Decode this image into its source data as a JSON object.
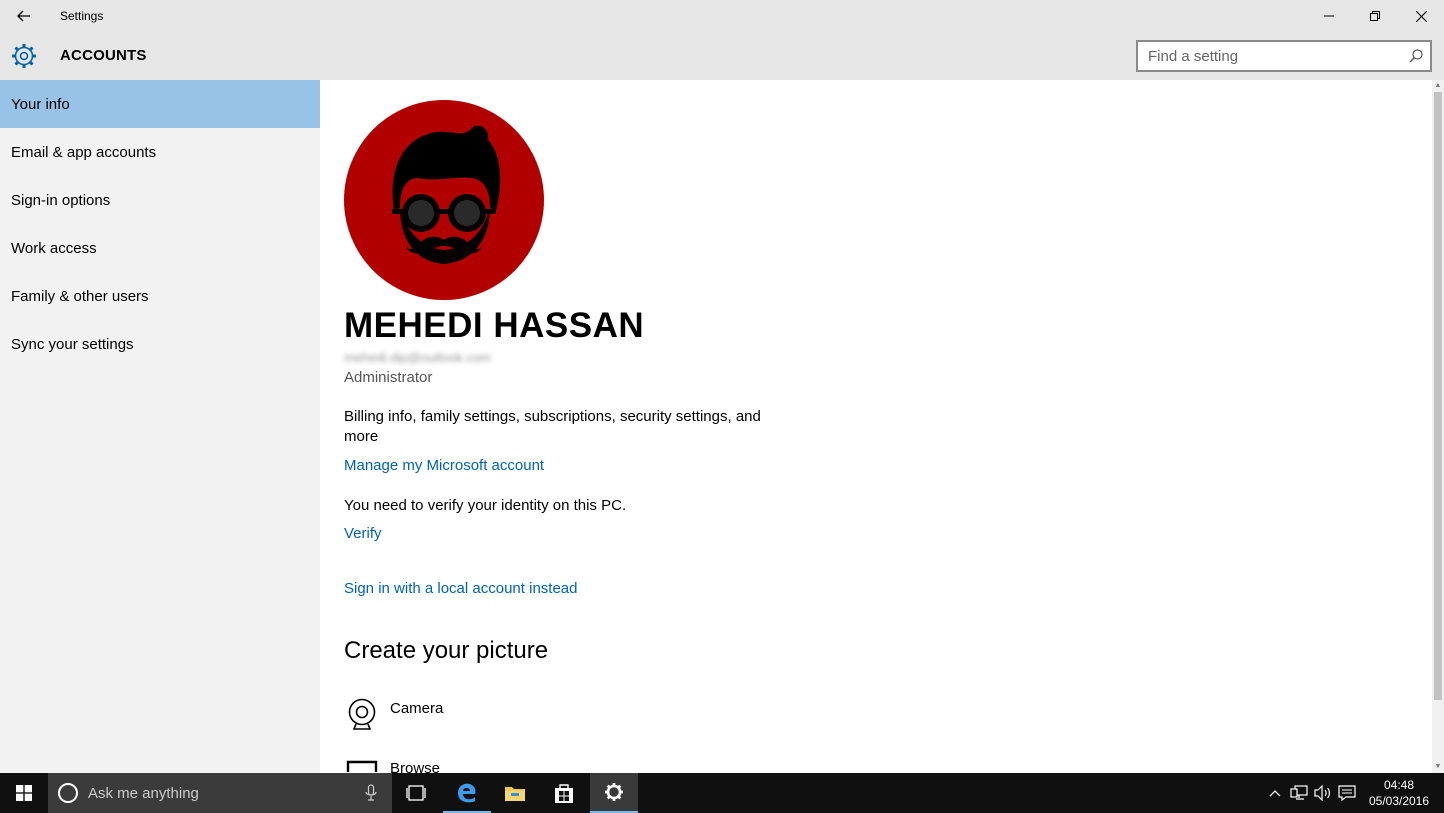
{
  "window": {
    "title": "Settings"
  },
  "header": {
    "section_title": "ACCOUNTS",
    "search_placeholder": "Find a setting"
  },
  "sidebar": {
    "items": [
      {
        "label": "Your info",
        "selected": true
      },
      {
        "label": "Email & app accounts"
      },
      {
        "label": "Sign-in options"
      },
      {
        "label": "Work access"
      },
      {
        "label": "Family & other users"
      },
      {
        "label": "Sync your settings"
      }
    ]
  },
  "profile": {
    "name": "MEHEDI HASSAN",
    "email": "mehedi.dip@outlook.com",
    "role": "Administrator",
    "billing_text": "Billing info, family settings, subscriptions, security settings, and more",
    "manage_link": "Manage my Microsoft account",
    "verify_text": "You need to verify your identity on this PC.",
    "verify_link": "Verify",
    "local_account_link": "Sign in with a local account instead",
    "avatar_color": "#b00000"
  },
  "create_picture": {
    "heading": "Create your picture",
    "options": [
      {
        "label": "Camera",
        "icon": "camera-icon"
      },
      {
        "label": "Browse",
        "icon": "browse-icon"
      }
    ]
  },
  "taskbar": {
    "search_placeholder": "Ask me anything",
    "apps": [
      "task-view-icon",
      "edge-icon",
      "file-explorer-icon",
      "store-icon",
      "settings-icon"
    ],
    "time": "04:48",
    "date": "05/03/2016"
  },
  "colors": {
    "accent": "#0063b1",
    "selected_nav": "#99c3e6",
    "taskbar": "#101010"
  }
}
